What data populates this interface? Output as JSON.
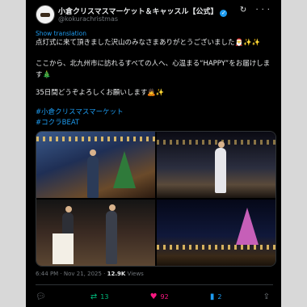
{
  "account": {
    "name": "小倉クリスマスマーケット＆キャッスル【公式】",
    "handle": "@kokurachristmas",
    "verified_glyph": "✓"
  },
  "header_icons": {
    "grok": "↻",
    "more": "···"
  },
  "translate_link": "Show translation",
  "post": {
    "line1": "点灯式に来て頂きました沢山のみなさまありがとうございました🎅✨✨",
    "line2": "ここから、北九州市に訪れるすべての人へ、心温まる“HAPPY”をお届けします🎄",
    "line3": "35日間どうぞよろしくお願いします🙇✨",
    "hashtag1": "#小倉クリスマスマーケット",
    "hashtag2": "#コクラBEAT"
  },
  "meta": {
    "time": "6:44 PM · Nov 21, 2025 · ",
    "views": "12.9K",
    "views_label": " Views"
  },
  "actions": {
    "reply": {
      "icon": "reply-icon",
      "count": ""
    },
    "repost": {
      "icon": "repost-icon",
      "count": "13",
      "color": "#00ba7c"
    },
    "like": {
      "icon": "heart-icon",
      "count": "92",
      "color": "#f91880"
    },
    "bookmark": {
      "icon": "bookmark-icon",
      "count": "2",
      "color": "#1d9bf0"
    },
    "share": {
      "icon": "share-icon",
      "count": ""
    }
  }
}
